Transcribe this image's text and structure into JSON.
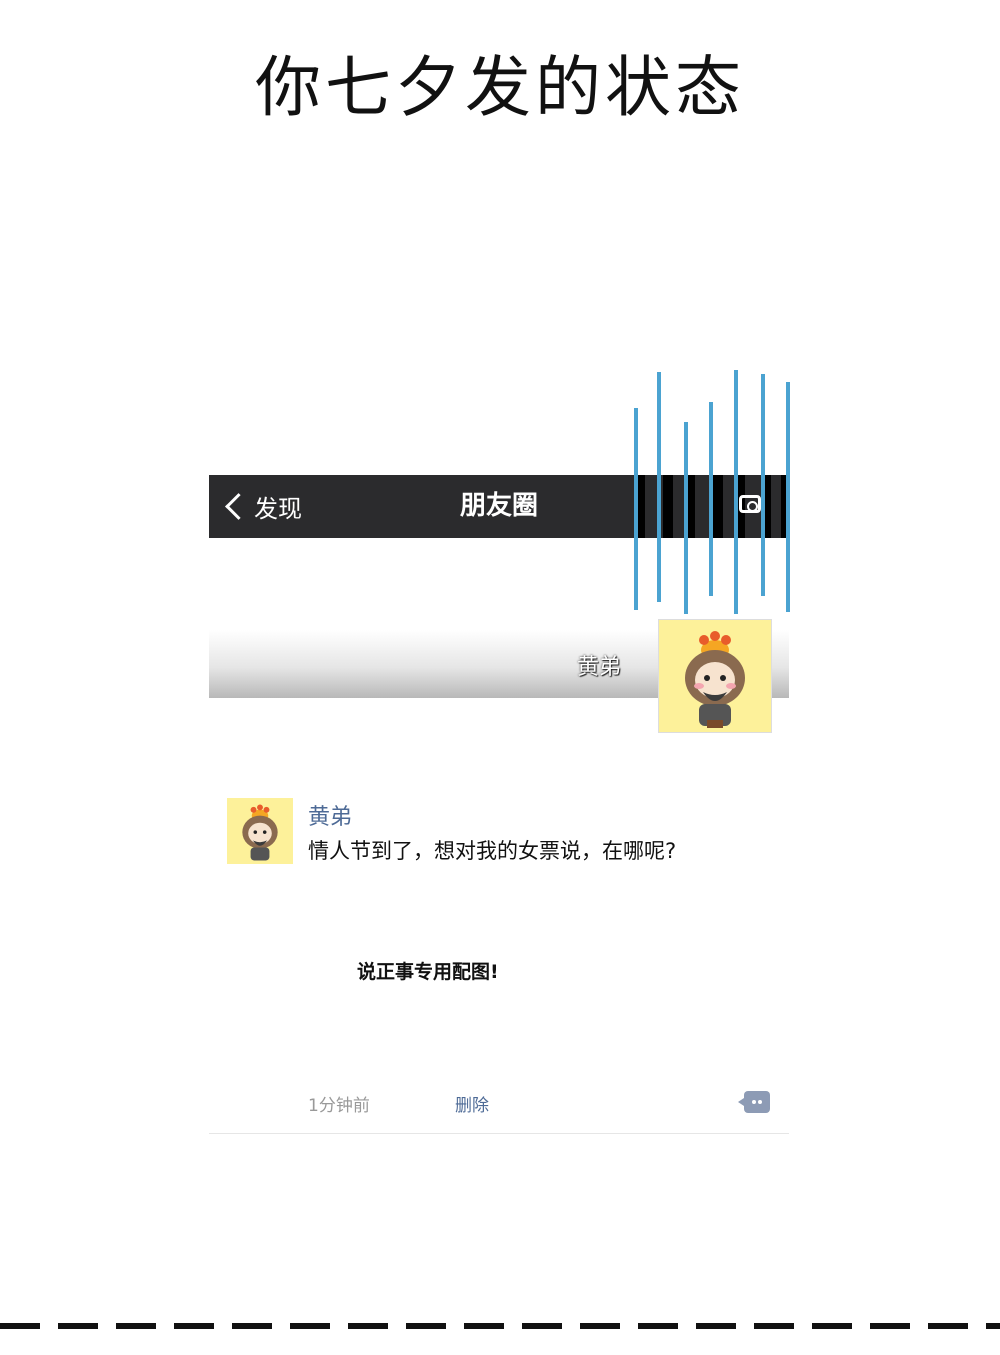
{
  "page": {
    "title": "你七夕发的状态"
  },
  "navbar": {
    "back_label": "发现",
    "title": "朋友圈"
  },
  "profile": {
    "cover_name": "黄弟"
  },
  "post": {
    "author": "黄弟",
    "text": "情人节到了，想对我的女票说，在哪呢?",
    "image_caption": "说正事专用配图!",
    "time": "1分钟前",
    "delete_label": "删除"
  },
  "colors": {
    "navbar_bg": "#2b2b2d",
    "link_blue": "#4d6a96",
    "decor_lines": "#4ba3d1",
    "avatar_bg": "#fdf19a"
  },
  "icons": [
    "chevron-left-icon",
    "camera-icon",
    "comment-icon"
  ]
}
